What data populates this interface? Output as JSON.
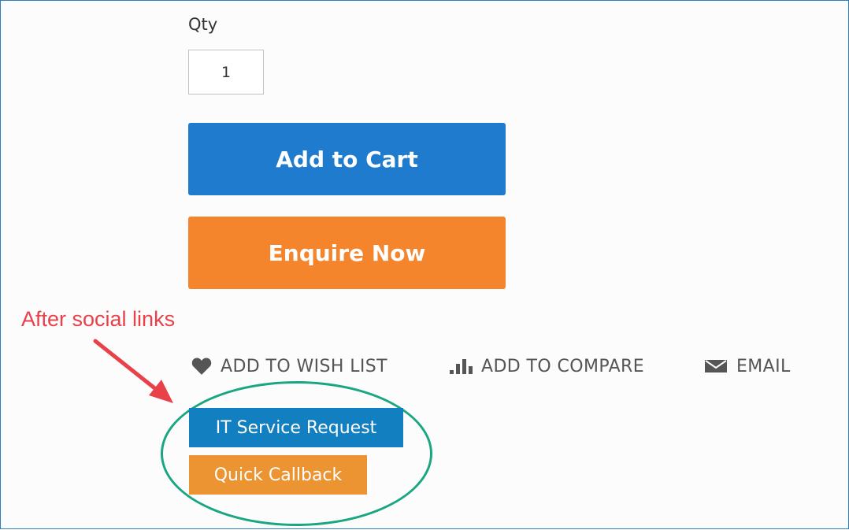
{
  "product": {
    "qty_label": "Qty",
    "qty_value": "1",
    "add_to_cart_label": "Add to Cart",
    "enquire_label": "Enquire Now"
  },
  "annotation": {
    "text": "After social links",
    "color": "#e8414a",
    "highlight_color": "#1aa681"
  },
  "social_links": {
    "wish_list": {
      "label": "ADD TO WISH LIST",
      "icon": "heart-icon"
    },
    "compare": {
      "label": "ADD TO COMPARE",
      "icon": "bar-chart-icon"
    },
    "email": {
      "label": "EMAIL",
      "icon": "envelope-icon"
    }
  },
  "extra_buttons": {
    "it_service_label": "IT Service Request",
    "quick_callback_label": "Quick Callback"
  },
  "colors": {
    "add_to_cart": "#1f7bce",
    "enquire": "#f4852c",
    "it_service": "#127fc1",
    "quick_callback": "#ec9431"
  }
}
